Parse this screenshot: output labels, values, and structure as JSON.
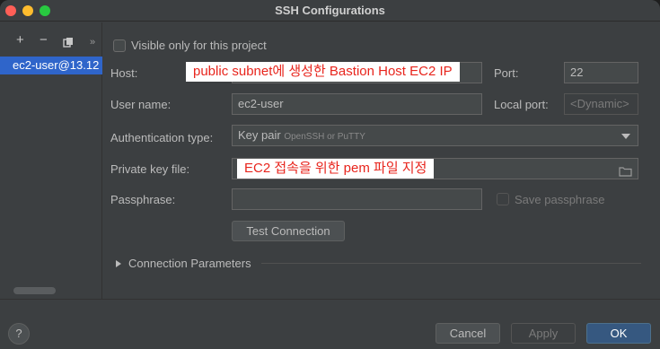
{
  "window": {
    "title": "SSH Configurations"
  },
  "sidebar": {
    "add_icon": "plus-icon",
    "remove_icon": "minus-icon",
    "copy_icon": "copy-icon",
    "more_icon": "double-chevron-right-icon",
    "add_glyph": "+",
    "remove_glyph": "−",
    "more_glyph": "»",
    "items": [
      {
        "label": "ec2-user@13.12",
        "selected": true
      }
    ]
  },
  "form": {
    "visible_only_label": "Visible only for this project",
    "visible_only_checked": false,
    "host_label": "Host:",
    "host_annotation": "public subnet에 생성한 Bastion Host EC2 IP",
    "port_label": "Port:",
    "port_value": "22",
    "username_label": "User name:",
    "username_value": "ec2-user",
    "local_port_label": "Local port:",
    "local_port_placeholder": "<Dynamic>",
    "auth_type_label": "Authentication type:",
    "auth_type_value": "Key pair",
    "auth_type_hint": "OpenSSH or PuTTY",
    "private_key_label": "Private key file:",
    "private_key_annotation": "EC2 접속을 위한 pem 파일 지정",
    "passphrase_label": "Passphrase:",
    "passphrase_value": "",
    "save_passphrase_label": "Save passphrase",
    "save_passphrase_checked": false,
    "test_connection_label": "Test Connection",
    "connection_params_label": "Connection Parameters"
  },
  "footer": {
    "help_glyph": "?",
    "cancel_label": "Cancel",
    "apply_label": "Apply",
    "ok_label": "OK"
  },
  "colors": {
    "accent": "#2f65ca",
    "primary_button": "#365880",
    "annotation_text": "#e8251d"
  }
}
